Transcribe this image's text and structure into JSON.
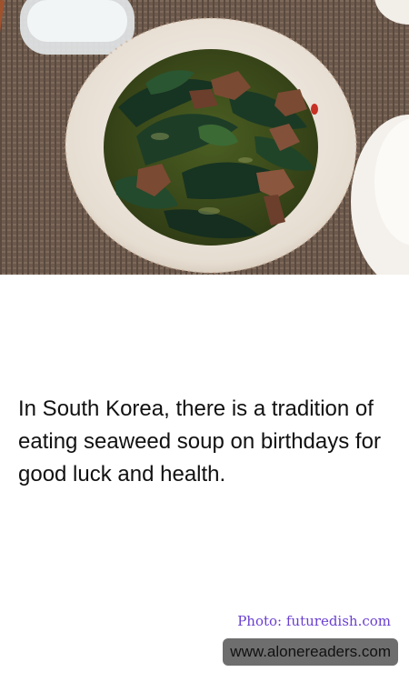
{
  "photo": {
    "alt": "",
    "colors": {
      "placemat": "#6d5a4d",
      "bowl": "#ece6dd",
      "broth": "#3f4f1f",
      "seaweed": "#173322",
      "beef": "#7a4a33"
    }
  },
  "fact": {
    "text": "In South Korea, there is a tradition of eating seaweed soup on birthdays for good luck and health."
  },
  "credit": {
    "text": "Photo: futuredish.com"
  },
  "site": {
    "url": "www.alonereaders.com"
  }
}
